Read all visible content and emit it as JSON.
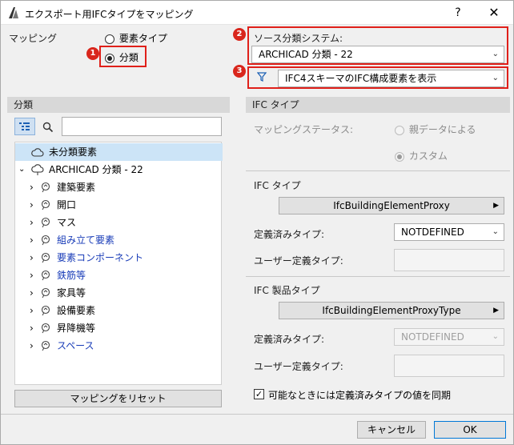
{
  "window": {
    "title": "エクスポート用IFCタイプをマッピング",
    "help": "?",
    "close": "✕"
  },
  "mapping": {
    "label": "マッピング",
    "option_element_type": "要素タイプ",
    "option_classification": "分類"
  },
  "source": {
    "label": "ソース分類システム:",
    "value": "ARCHICAD 分類 - 22",
    "filter_value": "IFC4スキーマのIFC構成要素を表示"
  },
  "badges": [
    "1",
    "2",
    "3"
  ],
  "left_panel": {
    "header": "分類",
    "tree": [
      {
        "label": "未分類要素",
        "selected": true,
        "indent": 0,
        "blue": false
      },
      {
        "label": "ARCHICAD 分類 - 22",
        "indent": 0,
        "expanded": true,
        "blue": false
      },
      {
        "label": "建築要素",
        "indent": 1,
        "blue": false
      },
      {
        "label": "開口",
        "indent": 1,
        "blue": false
      },
      {
        "label": "マス",
        "indent": 1,
        "blue": false
      },
      {
        "label": "組み立て要素",
        "indent": 1,
        "blue": true
      },
      {
        "label": "要素コンポーネント",
        "indent": 1,
        "blue": true
      },
      {
        "label": "鉄筋等",
        "indent": 1,
        "blue": true
      },
      {
        "label": "家具等",
        "indent": 1,
        "blue": false
      },
      {
        "label": "設備要素",
        "indent": 1,
        "blue": false
      },
      {
        "label": "昇降機等",
        "indent": 1,
        "blue": false
      },
      {
        "label": "スペース",
        "indent": 1,
        "blue": true
      }
    ],
    "reset_button": "マッピングをリセット"
  },
  "right_panel": {
    "header": "IFC タイプ",
    "status_label": "マッピングステータス:",
    "status_parent": "親データによる",
    "status_custom": "カスタム",
    "ifc_type_label": "IFC タイプ",
    "ifc_type_value": "IfcBuildingElementProxy",
    "predefined_label": "定義済みタイプ:",
    "predefined_value": "NOTDEFINED",
    "user_defined_label": "ユーザー定義タイプ:",
    "product_type_label": "IFC 製品タイプ",
    "product_type_value": "IfcBuildingElementProxyType",
    "predefined2_label": "定義済みタイプ:",
    "predefined2_value": "NOTDEFINED",
    "user_defined2_label": "ユーザー定義タイプ:",
    "sync_label": "可能なときには定義済みタイプの値を同期"
  },
  "footer": {
    "cancel": "キャンセル",
    "ok": "OK"
  },
  "colors": {
    "badge": "#d9261c",
    "highlight": "#e0201a",
    "selection": "#cce4f7",
    "blue_text": "#1a3db8"
  }
}
